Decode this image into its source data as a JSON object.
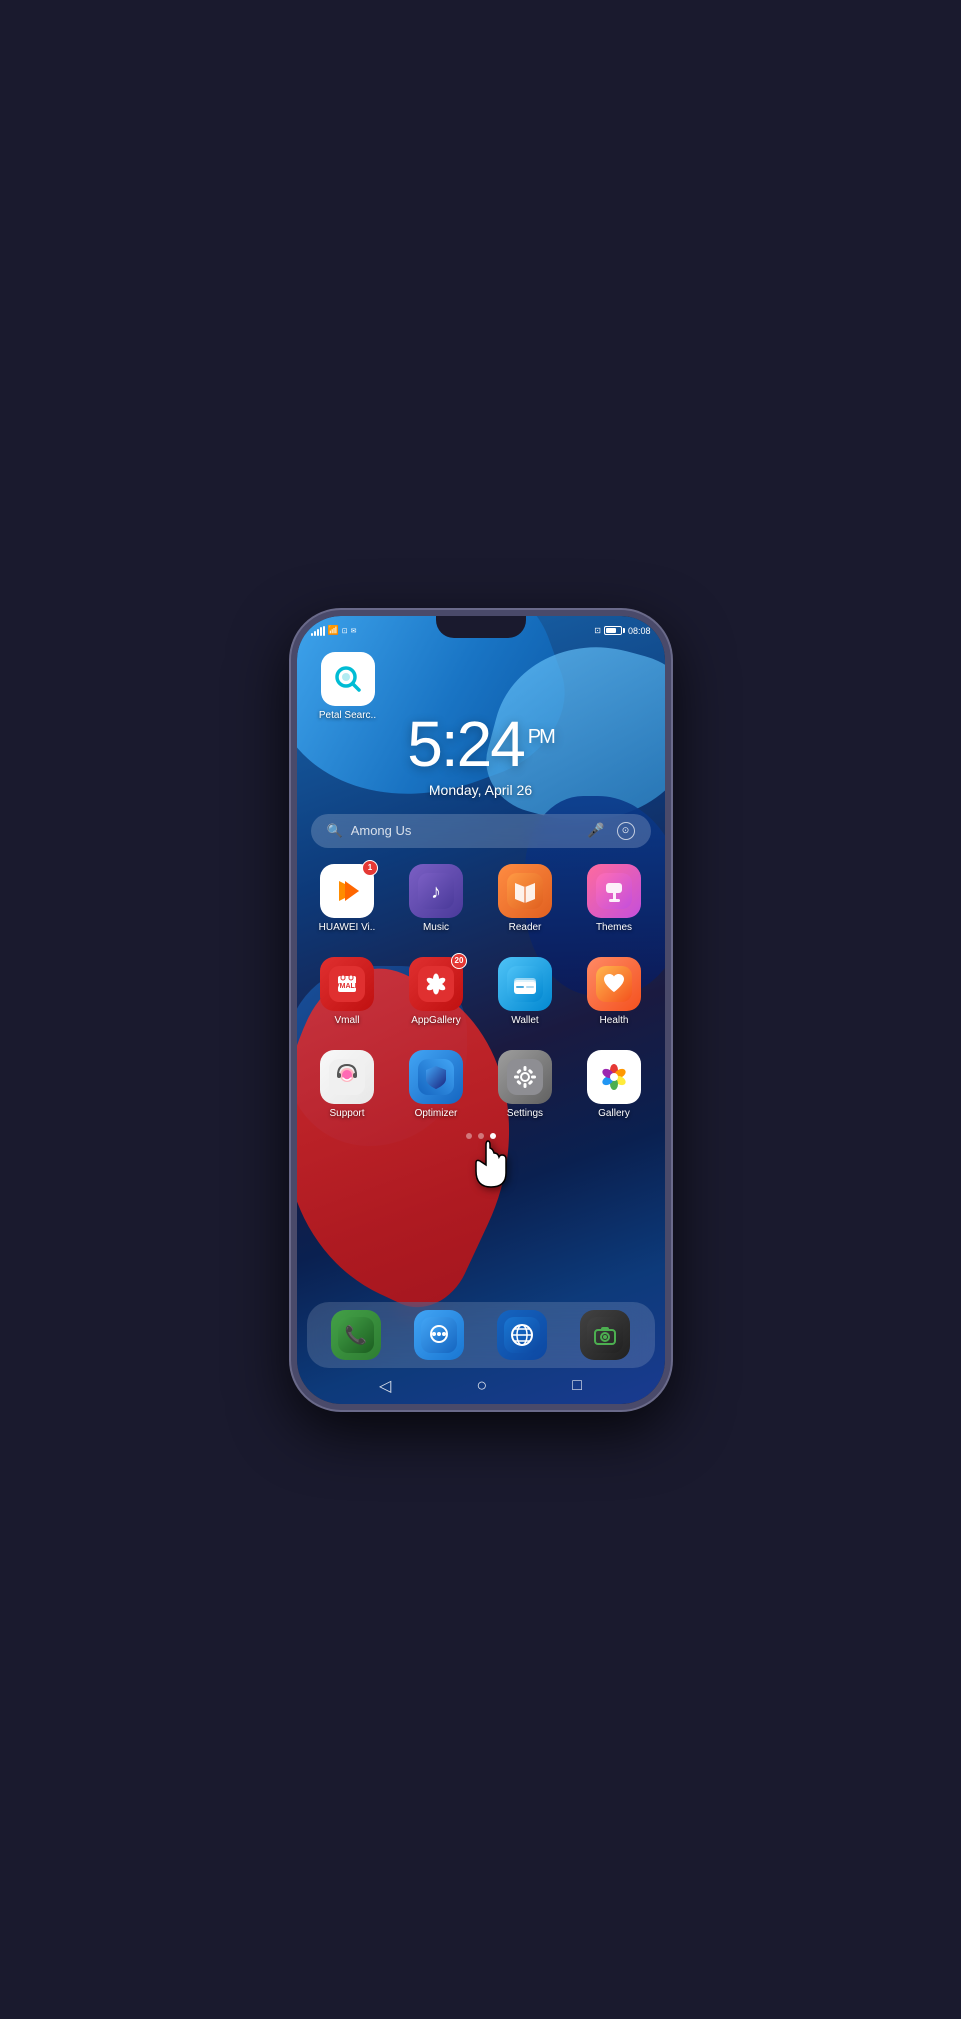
{
  "phone": {
    "status_bar": {
      "time": "08:08",
      "battery_level": 75
    },
    "clock": {
      "time": "5:24",
      "period": "PM",
      "date": "Monday, April 26"
    },
    "search": {
      "placeholder": "Among Us",
      "icon_search": "🔍",
      "icon_mic": "🎤",
      "icon_camera": "⊙"
    },
    "top_app": {
      "name": "Petal Searc..",
      "icon": "petal-search"
    },
    "app_rows": [
      [
        {
          "id": "huawei-video",
          "name": "HUAWEI Vi..",
          "badge": "1"
        },
        {
          "id": "music",
          "name": "Music",
          "badge": ""
        },
        {
          "id": "reader",
          "name": "Reader",
          "badge": ""
        },
        {
          "id": "themes",
          "name": "Themes",
          "badge": ""
        }
      ],
      [
        {
          "id": "vmall",
          "name": "Vmall",
          "badge": ""
        },
        {
          "id": "appgallery",
          "name": "AppGallery",
          "badge": "20"
        },
        {
          "id": "wallet",
          "name": "Wallet",
          "badge": ""
        },
        {
          "id": "health",
          "name": "Health",
          "badge": ""
        }
      ],
      [
        {
          "id": "support",
          "name": "Support",
          "badge": ""
        },
        {
          "id": "optimizer",
          "name": "Optimizer",
          "badge": ""
        },
        {
          "id": "settings",
          "name": "Settings",
          "badge": ""
        },
        {
          "id": "gallery",
          "name": "Gallery",
          "badge": ""
        }
      ]
    ],
    "page_dots": [
      {
        "active": false
      },
      {
        "active": false
      },
      {
        "active": true
      }
    ],
    "dock": [
      {
        "id": "phone",
        "name": "Phone"
      },
      {
        "id": "messages",
        "name": "Messages"
      },
      {
        "id": "browser",
        "name": "Browser"
      },
      {
        "id": "camera",
        "name": "Camera"
      }
    ],
    "nav": {
      "back": "◁",
      "home": "○",
      "recents": "□"
    }
  }
}
